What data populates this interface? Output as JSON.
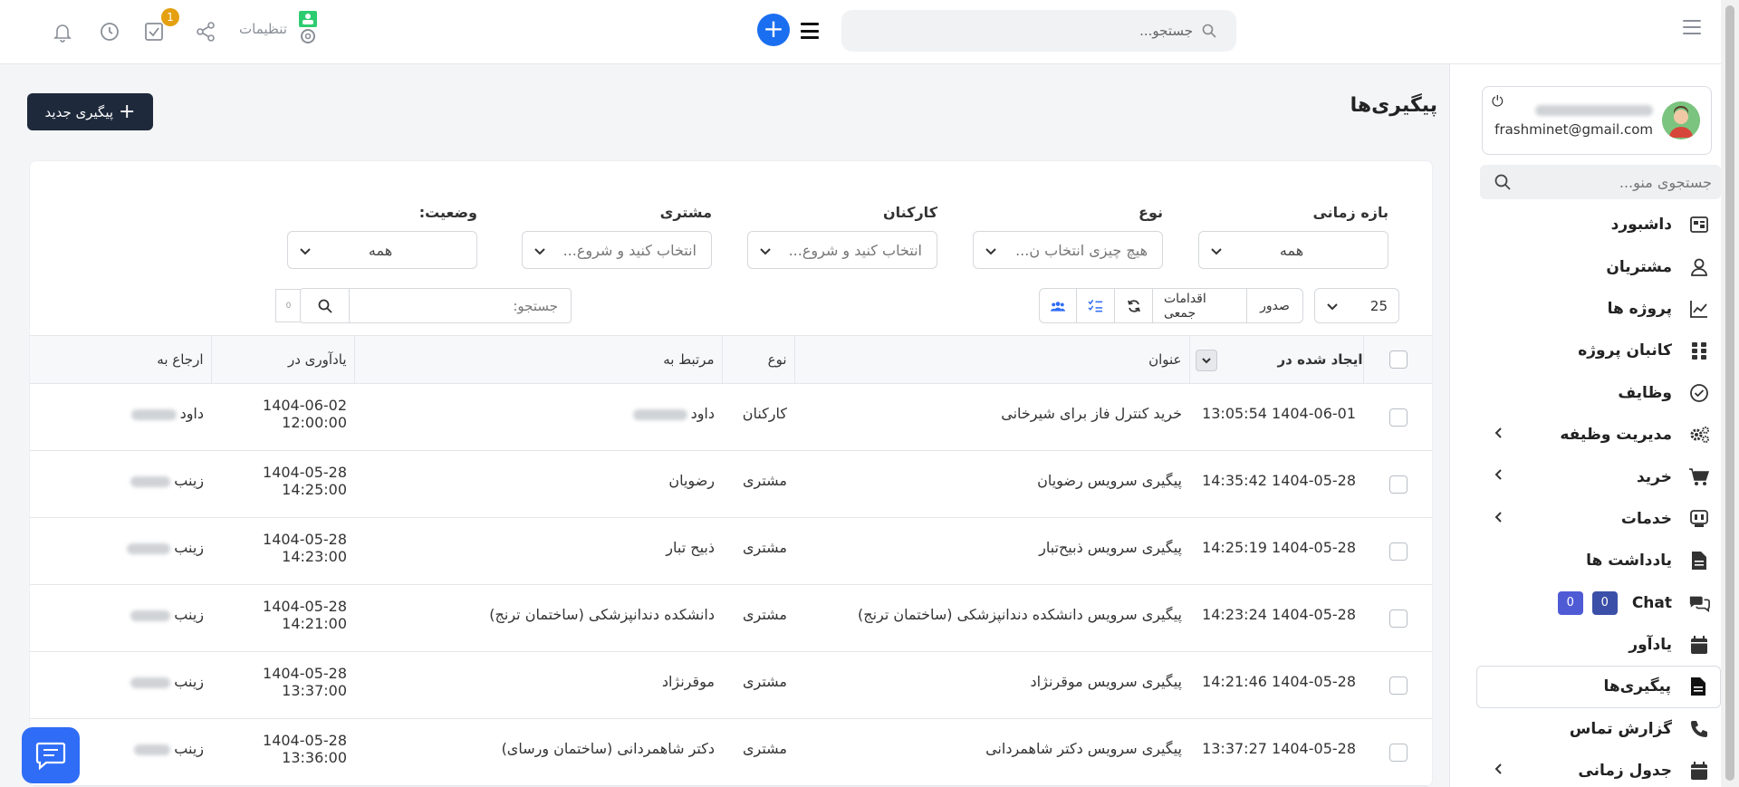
{
  "header": {
    "search_placeholder": "جستجو...",
    "settings_label": "تنظیمات",
    "task_badge": "1"
  },
  "sidebar": {
    "user_email": "frashminet@gmail.com",
    "menu_search_placeholder": "جستجوی منو...",
    "items": [
      {
        "label": "داشبورد",
        "icon": "dashboard-icon"
      },
      {
        "label": "مشتریان",
        "icon": "user-icon"
      },
      {
        "label": "پروژه ها",
        "icon": "chart-icon"
      },
      {
        "label": "کانبان پروژه",
        "icon": "grid-icon"
      },
      {
        "label": "وظایف",
        "icon": "check-circle-icon"
      },
      {
        "label": "مدیریت وظیفه",
        "icon": "gears-icon",
        "has_children": true
      },
      {
        "label": "خرید",
        "icon": "cart-icon",
        "has_children": true
      },
      {
        "label": "خدمات",
        "icon": "service-icon",
        "has_children": true
      },
      {
        "label": "یادداشت ها",
        "icon": "note-icon"
      },
      {
        "label": "Chat",
        "icon": "chat-icon",
        "badges": [
          "0",
          "0"
        ]
      },
      {
        "label": "یادآور",
        "icon": "calendar-icon"
      },
      {
        "label": "پیگیری‌ها",
        "icon": "file-icon",
        "active": true
      },
      {
        "label": "گزارش تماس",
        "icon": "phone-icon"
      },
      {
        "label": "جدول زمانی",
        "icon": "calendar-icon",
        "has_children": true
      }
    ]
  },
  "page": {
    "title": "پیگیری‌ها",
    "new_button": "پیگیری جدید"
  },
  "filters": {
    "period": {
      "label": "بازه زمانی",
      "value": "همه"
    },
    "type": {
      "label": "نوع",
      "value": "هیچ چیزی انتخاب ن..."
    },
    "staff": {
      "label": "کارکنان",
      "value": "انتخاب کنید و شروع..."
    },
    "customer": {
      "label": "مشتری",
      "value": "انتخاب کنید و شروع..."
    },
    "status": {
      "label": "وضعیت:",
      "value": "همه"
    }
  },
  "toolbar": {
    "per_page": "25",
    "export": "صدور",
    "bulk_actions": "اقدامات جمعی",
    "search_placeholder": "جستجو:",
    "mini_label": "0"
  },
  "table": {
    "headers": {
      "created": "ایجاد شده در",
      "title": "عنوان",
      "type": "نوع",
      "related": "مرتبط به",
      "reminder": "یادآوری در",
      "assigned": "ارجاع به"
    },
    "rows": [
      {
        "created": "1404-06-01 13:05:54",
        "title": "خرید کنترل فاز برای شیرخانی",
        "type": "کارکنان",
        "related": "داود",
        "reminder": "1404-06-02 12:00:00",
        "assigned": "داود"
      },
      {
        "created": "1404-05-28 14:35:42",
        "title": "پیگیری سرویس رضویان",
        "type": "مشتری",
        "related": "رضویان",
        "reminder": "1404-05-28 14:25:00",
        "assigned": "زینب"
      },
      {
        "created": "1404-05-28 14:25:19",
        "title": "پیگیری سرویس ذبیح‌تبار",
        "type": "مشتری",
        "related": "ذبیح تبار",
        "reminder": "1404-05-28 14:23:00",
        "assigned": "زینب"
      },
      {
        "created": "1404-05-28 14:23:24",
        "title": "پیگیری سرویس دانشکده دندانپزشکی (ساختمان ترنج)",
        "type": "مشتری",
        "related": "دانشکده دندانپزشکی (ساختمان ترنج)",
        "reminder": "1404-05-28 14:21:00",
        "assigned": "زینب"
      },
      {
        "created": "1404-05-28 14:21:46",
        "title": "پیگیری سرویس موقرنژاد",
        "type": "مشتری",
        "related": "موقرنژاد",
        "reminder": "1404-05-28 13:37:00",
        "assigned": "زینب"
      },
      {
        "created": "1404-05-28 13:37:27",
        "title": "پیگیری سرویس دکتر شاهمردانی",
        "type": "مشتری",
        "related": "دکتر شاهمردانی (ساختمان ورسای)",
        "reminder": "1404-05-28 13:36:00",
        "assigned": "زینب"
      }
    ]
  },
  "colors": {
    "accent": "#1a6ff0",
    "dark_button": "#1e293b",
    "badge": "#e4a010",
    "chat_badge_1": "#4f5bd5",
    "chat_badge_2": "#3c4fa8"
  }
}
